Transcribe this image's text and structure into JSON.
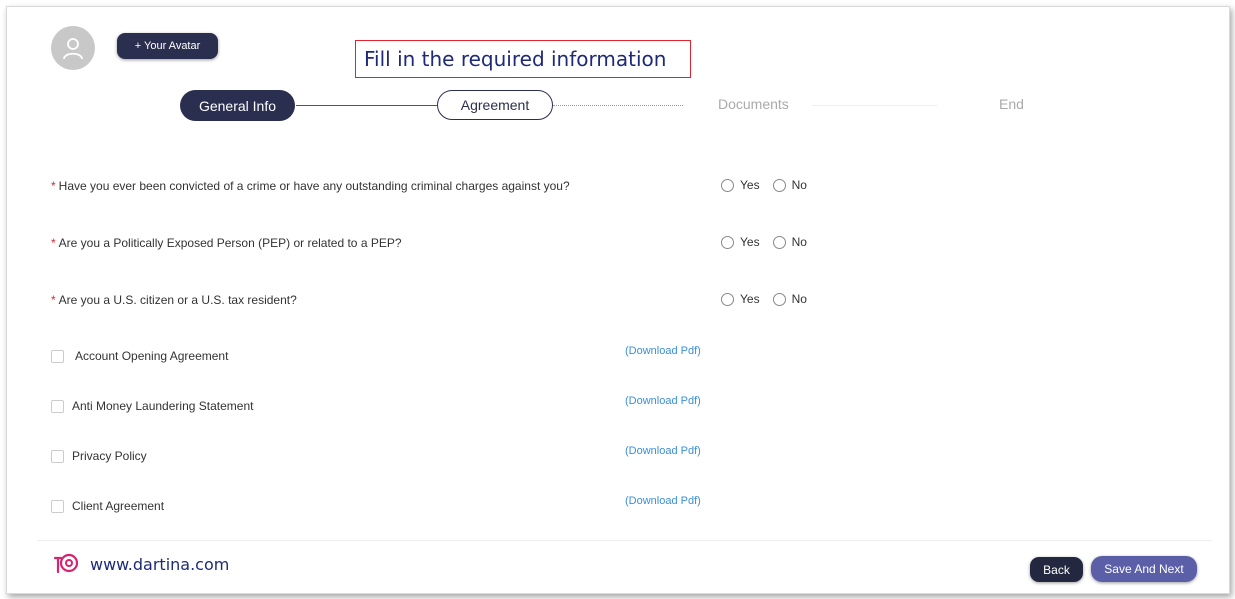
{
  "header": {
    "avatar_button_label": "+ Your Avatar",
    "annotation": "Fill in the required information"
  },
  "steps": [
    {
      "label": "General Info",
      "state": "completed"
    },
    {
      "label": "Agreement",
      "state": "current"
    },
    {
      "label": "Documents",
      "state": "upcoming"
    },
    {
      "label": "End",
      "state": "upcoming"
    }
  ],
  "questions": [
    {
      "text": "Have you ever been convicted of a crime or have any outstanding criminal charges against you?",
      "yes": "Yes",
      "no": "No"
    },
    {
      "text": "Are you a Politically Exposed Person (PEP) or related to a PEP?",
      "yes": "Yes",
      "no": "No"
    },
    {
      "text": "Are you a U.S. citizen or a U.S. tax resident?",
      "yes": "Yes",
      "no": "No"
    }
  ],
  "required_marker": "*",
  "agreements": [
    {
      "label": "Account Opening Agreement",
      "link": "(Download Pdf)"
    },
    {
      "label": "Anti Money Laundering Statement",
      "link": "(Download Pdf)"
    },
    {
      "label": "Privacy Policy",
      "link": "(Download Pdf)"
    },
    {
      "label": "Client Agreement",
      "link": "(Download Pdf)"
    }
  ],
  "footer": {
    "brand": "www.dartina.com",
    "back_label": "Back",
    "save_label": "Save And Next"
  },
  "colors": {
    "primary_dark": "#2b2f4f",
    "accent": "#5a5fa8",
    "required": "#e0232e",
    "link": "#3a8fd9",
    "brand_logo": "#d6246e"
  }
}
